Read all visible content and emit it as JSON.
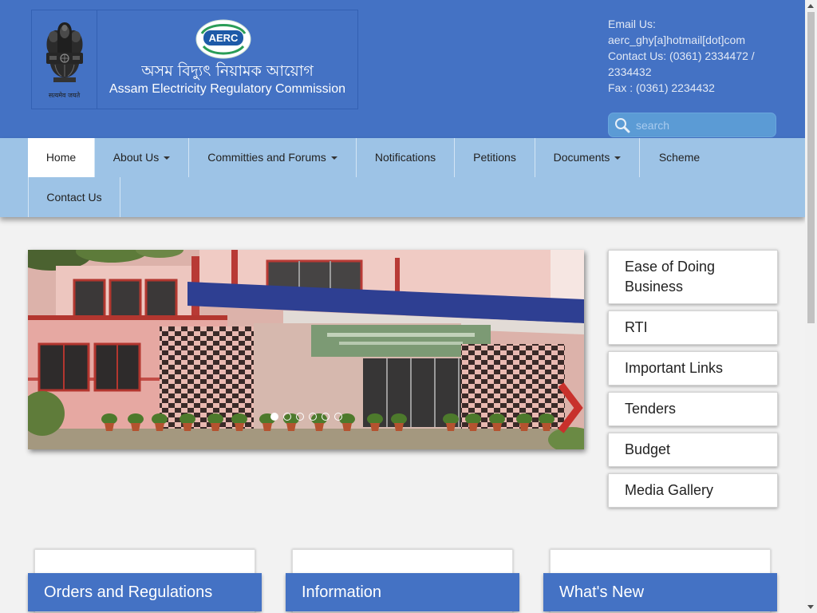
{
  "colors": {
    "header_bg": "#4472c4",
    "nav_bg": "#9dc3e6",
    "page_bg": "#f2f2f2",
    "search_bg": "#5b9bd5",
    "slider_arrow": "#c8312c",
    "section_header_bg": "#4472c4"
  },
  "header": {
    "emblem": {
      "icon": "national-emblem-icon",
      "motto": "सत्यमेव जयते"
    },
    "logo": {
      "icon": "aerc-logo",
      "abbr": "AERC",
      "title_bn": "অসম বিদ্যুৎ নিয়ামক আয়োগ",
      "title_en": "Assam Electricity Regulatory Commission"
    },
    "contact": {
      "email_label": "Email Us:",
      "email": "aerc_ghy[a]hotmail[dot]com",
      "phone": "Contact Us: (0361) 2334472 / 2334432",
      "fax": "Fax : (0361) 2234432"
    },
    "search": {
      "icon": "search-icon",
      "placeholder": "search",
      "value": ""
    }
  },
  "nav": {
    "dropdown_icon": "caret-down-icon",
    "items": [
      {
        "label": "Home",
        "active": true,
        "dropdown": false
      },
      {
        "label": "About Us",
        "active": false,
        "dropdown": true
      },
      {
        "label": "Committies and Forums",
        "active": false,
        "dropdown": true
      },
      {
        "label": "Notifications",
        "active": false,
        "dropdown": false
      },
      {
        "label": "Petitions",
        "active": false,
        "dropdown": false
      },
      {
        "label": "Documents",
        "active": false,
        "dropdown": true
      },
      {
        "label": "Scheme",
        "active": false,
        "dropdown": false
      },
      {
        "label": "Contact Us",
        "active": false,
        "dropdown": false
      }
    ]
  },
  "slider": {
    "slide_count": 6,
    "active_index": 0,
    "next_icon": "chevron-right-icon"
  },
  "quick_links": [
    "Ease of Doing Business",
    "RTI",
    "Important Links",
    "Tenders",
    "Budget",
    "Media Gallery"
  ],
  "sections": [
    {
      "title": "Orders and Regulations"
    },
    {
      "title": "Information"
    },
    {
      "title": "What's New"
    }
  ],
  "scrollbar": {
    "up_icon": "scroll-up-arrow-icon",
    "down_icon": "scroll-down-arrow-icon"
  }
}
